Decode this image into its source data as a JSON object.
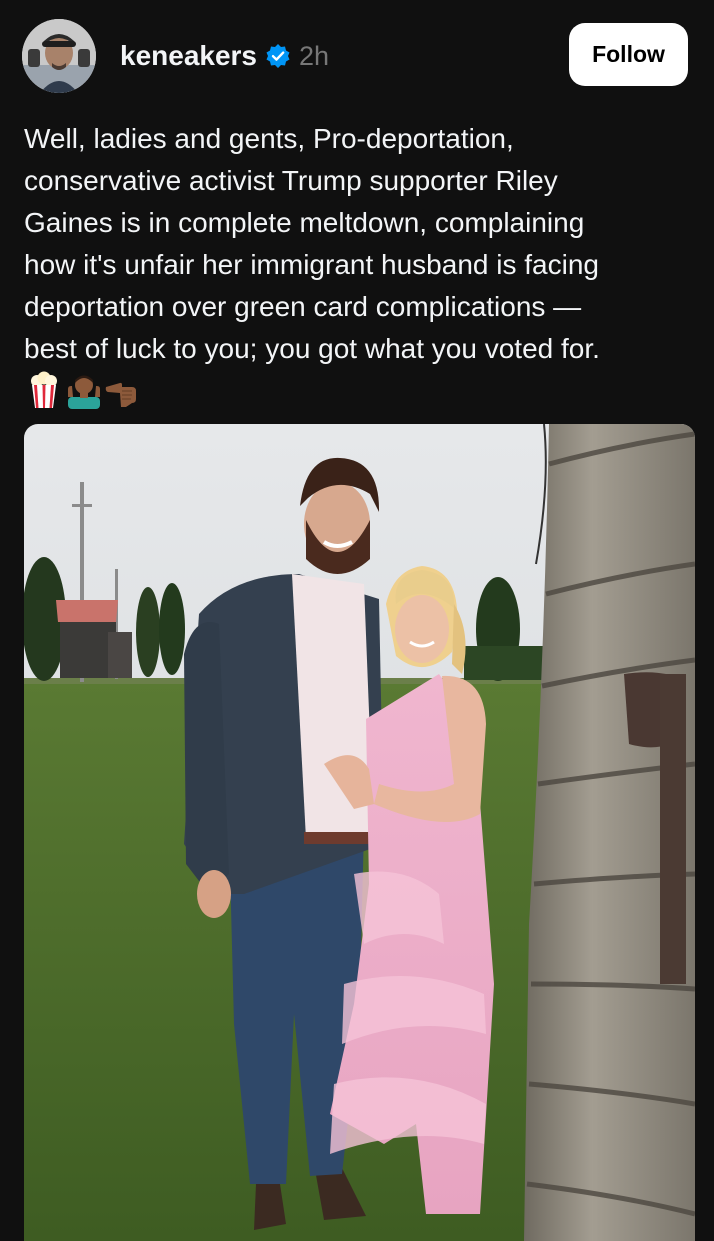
{
  "post": {
    "username": "keneakers",
    "timestamp": "2h",
    "follow_label": "Follow",
    "text_lines": [
      "Well, ladies and gents, Pro-deportation,",
      "conservative activist Trump supporter Riley",
      "Gaines is in complete meltdown, complaining",
      "how it's unfair her immigrant husband is facing",
      "deportation over green card complications —",
      "best of luck to you; you got what you voted for."
    ],
    "emojis": [
      "popcorn-icon",
      "person-shrugging-icon",
      "backhand-index-pointing-left-icon"
    ]
  },
  "colors": {
    "background": "#101010",
    "text": "#f3f5f7",
    "muted": "#777777",
    "verified": "#0095f6",
    "follow_bg": "#ffffff"
  }
}
